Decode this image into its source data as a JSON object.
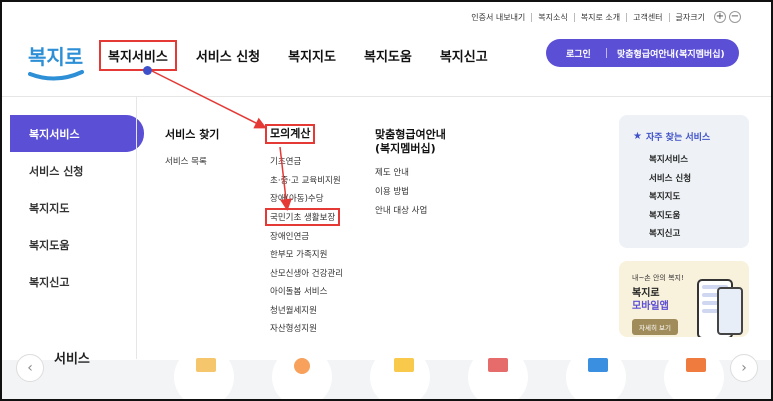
{
  "utility": {
    "items": [
      "인증서 내보내기",
      "복지소식",
      "복지로 소개",
      "고객센터",
      "글자크기"
    ],
    "zoom_in": "+",
    "zoom_out": "−"
  },
  "logo": {
    "text": "복지로"
  },
  "nav": {
    "items": [
      "복지서비스",
      "서비스 신청",
      "복지지도",
      "복지도움",
      "복지신고"
    ]
  },
  "account": {
    "login": "로그인",
    "membership": "맞춤형급여안내(복지멤버십)"
  },
  "side_menu": [
    "복지서비스",
    "서비스 신청",
    "복지지도",
    "복지도움",
    "복지신고"
  ],
  "col1": {
    "title": "서비스 찾기",
    "items": [
      "서비스 목록"
    ]
  },
  "col2": {
    "title": "모의계산",
    "items": [
      "기초연금",
      "초·중·고 교육비지원",
      "장애(아동)수당",
      "국민기초 생활보장",
      "장애인연금",
      "한부모 가족지원",
      "산모신생아 건강관리",
      "아이돌봄 서비스",
      "청년월세지원",
      "자산형성지원"
    ]
  },
  "col3": {
    "title_line1": "맞춤형급여안내",
    "title_line2": "(복지멤버십)",
    "items": [
      "제도 안내",
      "이용 방법",
      "안내 대상 사업"
    ]
  },
  "favorites": {
    "title": "자주 찾는 서비스",
    "items": [
      "복지서비스",
      "서비스 신청",
      "복지지도",
      "복지도움",
      "복지신고"
    ]
  },
  "app_promo": {
    "line1": "내~손 안의 복지!",
    "line2": "복지로",
    "line3": "모바일앱",
    "button": "자세히 보기"
  },
  "bottom": {
    "partial_title": "서비스",
    "prev": "‹",
    "next": "›"
  },
  "colors": {
    "primary": "#5b4fd6",
    "highlight": "#e53935",
    "logo": "#2d8fd6"
  }
}
